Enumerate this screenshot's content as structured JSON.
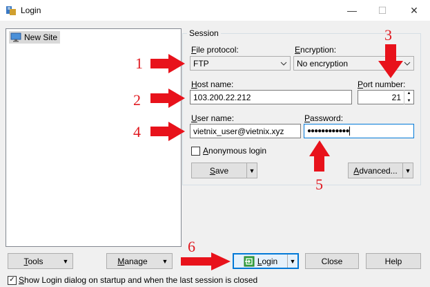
{
  "window": {
    "title": "Login",
    "minimize": "—",
    "maximize": "☐",
    "close": "✕"
  },
  "sites": {
    "items": [
      {
        "label": "New Site",
        "icon": "monitor-icon"
      }
    ]
  },
  "session": {
    "group_label": "Session",
    "file_protocol": {
      "label_u": "F",
      "label_rest": "ile protocol:",
      "value": "FTP"
    },
    "encryption": {
      "label_u": "E",
      "label_rest": "ncryption:",
      "value": "No encryption"
    },
    "host": {
      "label_u": "H",
      "label_rest": "ost name:",
      "value": "103.200.22.212"
    },
    "port": {
      "label_u": "P",
      "label_rest": "ort number:",
      "value": "21"
    },
    "user": {
      "label_u": "U",
      "label_rest": "ser name:",
      "value": "vietnix_user@vietnix.xyz"
    },
    "password": {
      "label_u": "P",
      "label_rest": "assword:",
      "value": "●●●●●●●●●●●●"
    },
    "anonymous": {
      "label_u": "A",
      "label_rest": "nonymous login",
      "checked": false
    },
    "save": {
      "label_u": "S",
      "label_rest": "ave"
    },
    "advanced": {
      "label_u": "A",
      "label_rest": "dvanced..."
    }
  },
  "bottom": {
    "tools": {
      "label_u": "T",
      "label_rest": "ools"
    },
    "manage": {
      "label_u": "M",
      "label_rest": "anage"
    },
    "login": {
      "label_u": "L",
      "label_rest": "ogin"
    },
    "close": "Close",
    "help": "Help",
    "show_login": {
      "label_u": "S",
      "label_rest": "how Login dialog on startup and when the last session is closed",
      "checked": true
    }
  },
  "annotations": [
    "1",
    "2",
    "3",
    "4",
    "5",
    "6"
  ],
  "colors": {
    "arrow": "#e8121b",
    "annotation_text": "#e0181f",
    "default_button_border": "#0078d7"
  }
}
